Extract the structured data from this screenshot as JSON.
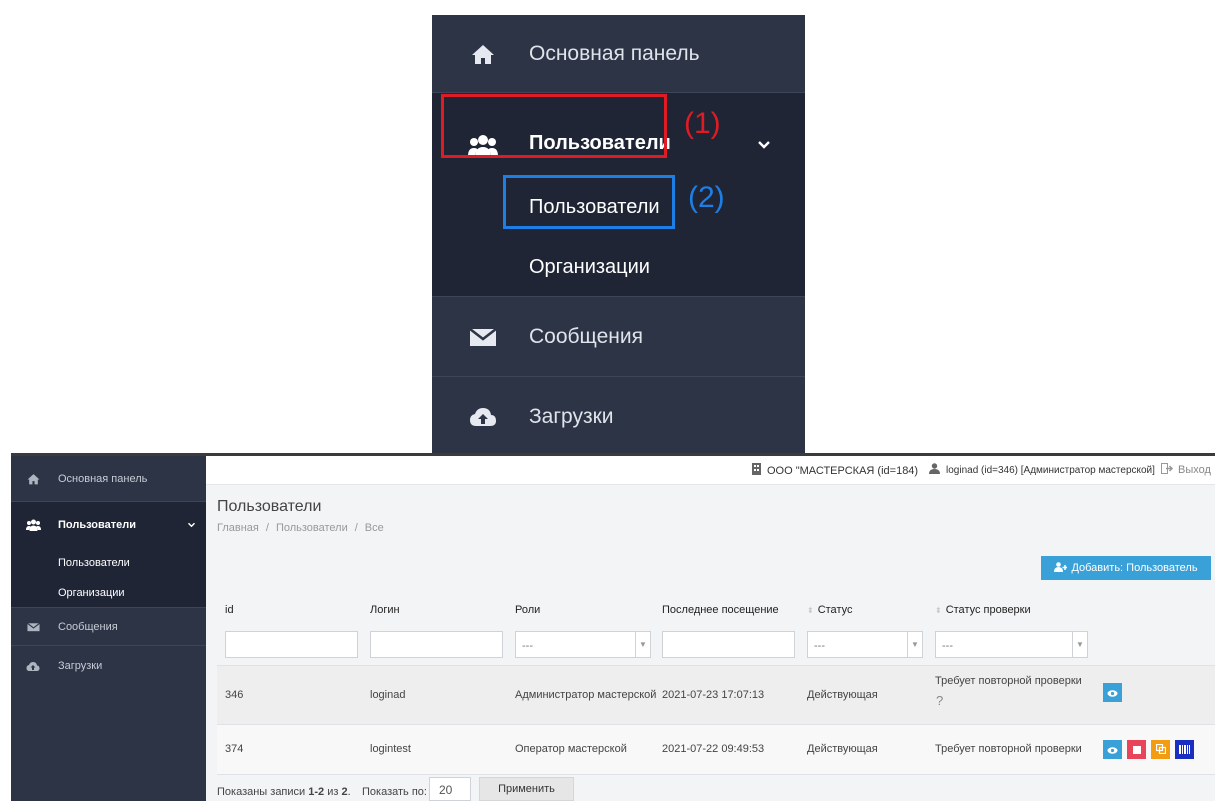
{
  "zoom_sidebar": {
    "items": [
      {
        "label": "Основная панель",
        "icon": "home-icon"
      },
      {
        "label": "Пользователи",
        "icon": "users-icon"
      },
      {
        "label": "Пользователи"
      },
      {
        "label": "Организации"
      },
      {
        "label": "Сообщения",
        "icon": "envelope-icon"
      },
      {
        "label": "Загрузки",
        "icon": "cloud-upload-icon"
      }
    ],
    "marker1": "(1)",
    "marker2": "(2)",
    "marker1_color": "#e01b24",
    "marker2_color": "#1d7fe6"
  },
  "sidebar": {
    "items": [
      {
        "label": "Основная панель",
        "icon": "home-icon"
      },
      {
        "label": "Пользователи",
        "icon": "users-icon"
      },
      {
        "label": "Пользователи"
      },
      {
        "label": "Организации"
      },
      {
        "label": "Сообщения",
        "icon": "envelope-icon"
      },
      {
        "label": "Загрузки",
        "icon": "cloud-upload-icon"
      }
    ]
  },
  "topbar": {
    "org": "ООО \"МАСТЕРСКАЯ (id=184)",
    "user": "loginad (id=346) [Администратор мастерской]",
    "exit": "Выход"
  },
  "page": {
    "title": "Пользователи",
    "breadcrumbs": [
      "Главная",
      "Пользователи",
      "Все"
    ],
    "add_button": "Добавить: Пользователь"
  },
  "table": {
    "columns": [
      "id",
      "Логин",
      "Роли",
      "Последнее посещение",
      "Статус",
      "Статус проверки"
    ],
    "filter_select_placeholder": "---",
    "rows": [
      {
        "id": "346",
        "login": "loginad",
        "roles": "Администратор мастерской",
        "last_visit": "2021-07-23 17:07:13",
        "status": "Действующая",
        "check_status": "Требует повторной проверки"
      },
      {
        "id": "374",
        "login": "logintest",
        "roles": "Оператор мастерской",
        "last_visit": "2021-07-22 09:49:53",
        "status": "Действующая",
        "check_status": "Требует повторной проверки"
      }
    ]
  },
  "footer": {
    "shown_prefix": "Показаны записи ",
    "shown_range": "1-2",
    "shown_of": " из ",
    "shown_total": "2",
    "shown_suffix": ".",
    "per_page_label": "Показать по:",
    "per_page_value": "20",
    "apply_button": "Применить"
  },
  "colors": {
    "sidebar_bg": "#2d3446",
    "sidebar_active_bg": "#1f2535",
    "accent": "#3aa1d8"
  }
}
